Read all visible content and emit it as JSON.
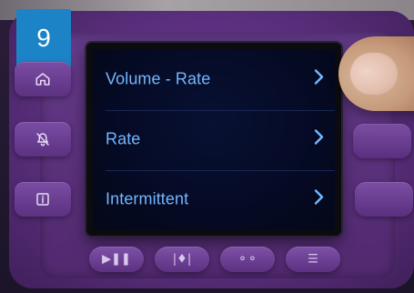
{
  "step_badge": {
    "number": "9",
    "color": "#1c84c6"
  },
  "side_buttons_left": [
    {
      "icon": "home-icon"
    },
    {
      "icon": "bell-off-icon"
    },
    {
      "icon": "info-icon"
    }
  ],
  "screen": {
    "menu": [
      {
        "label": "Volume - Rate",
        "chevron": "chevron-right-icon"
      },
      {
        "label": "Rate",
        "chevron": "chevron-right-icon"
      },
      {
        "label": "Intermittent",
        "chevron": "chevron-right-icon"
      }
    ],
    "colors": {
      "text": "#74b7ff",
      "background": "#050a24"
    }
  },
  "bottom_buttons": [
    {
      "icon": "play-pause-icon",
      "glyph": "▶❚❚"
    },
    {
      "icon": "adjust-icon",
      "glyph": "|♦|"
    },
    {
      "icon": "options-icon",
      "glyph": "⚬⚬"
    },
    {
      "icon": "menu-icon",
      "glyph": "☰"
    }
  ],
  "device": {
    "body_color": "#5a2f7d"
  }
}
